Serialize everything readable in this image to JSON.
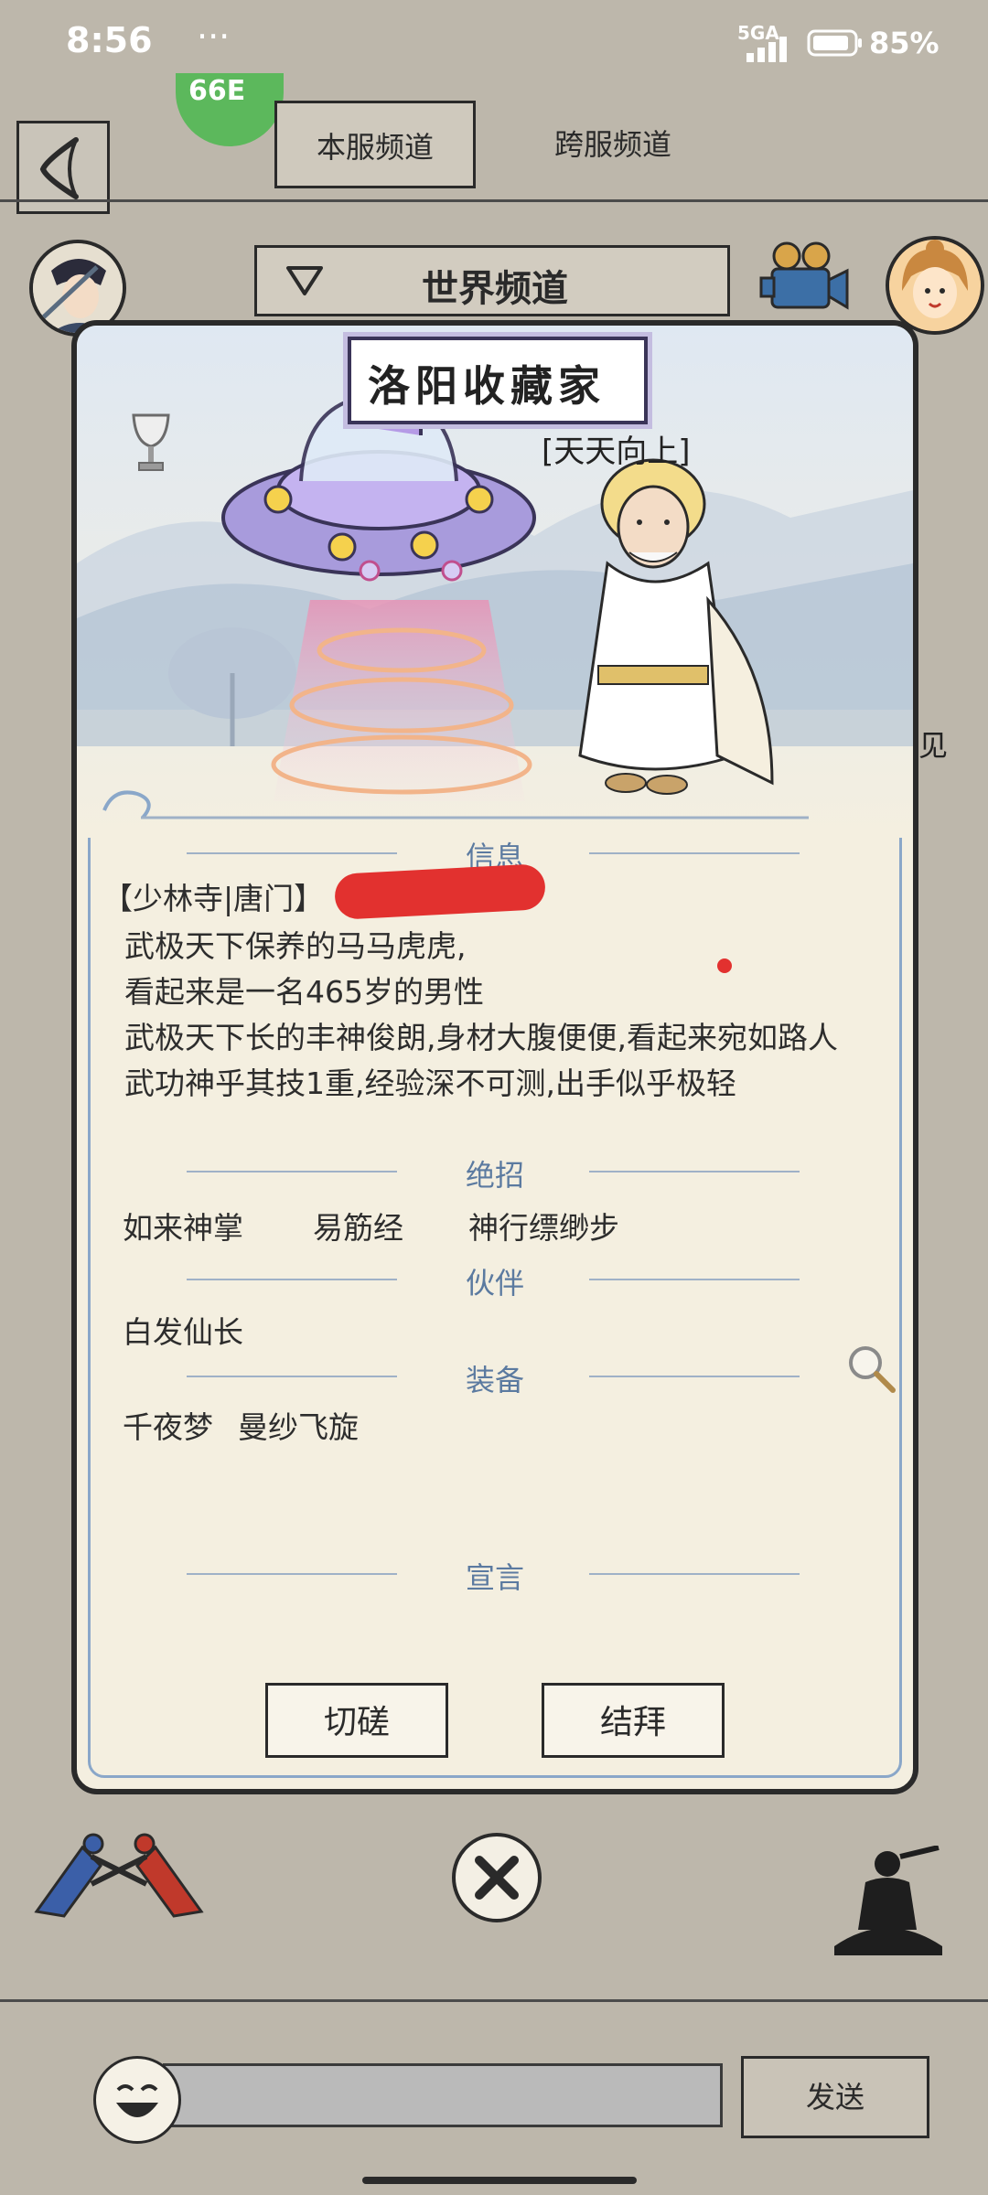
{
  "status_bar": {
    "time": "8:56",
    "dots": "···",
    "network": "5GA",
    "battery": "85%"
  },
  "tabs": {
    "local": "本服频道",
    "cross": "跨服频道",
    "badge": "66E"
  },
  "channel": {
    "title": "世界频道"
  },
  "card": {
    "title": "洛阳收藏家",
    "guild_tag": "[天天向上]",
    "sections": {
      "info": "信息",
      "moves": "绝招",
      "partner": "伙伴",
      "equipment": "装备",
      "declaration": "宣言"
    },
    "info_header": "【少林寺|唐门】",
    "info_lines": [
      "武极天下保养的马马虎虎,",
      "看起来是一名465岁的男性",
      "武极天下长的丰神俊朗,身材大腹便便,看起来宛如路人",
      "武功神乎其技1重,经验深不可测,出手似乎极轻"
    ],
    "moves": [
      "如来神掌",
      "易筋经",
      "神行缥缈步"
    ],
    "partner": "白发仙长",
    "equipment": [
      "千夜梦",
      "曼纱飞旋"
    ],
    "buttons": {
      "spar": "切磋",
      "sworn": "结拜"
    }
  },
  "side_peek": "见",
  "chat": {
    "send": "发送",
    "input_value": ""
  }
}
